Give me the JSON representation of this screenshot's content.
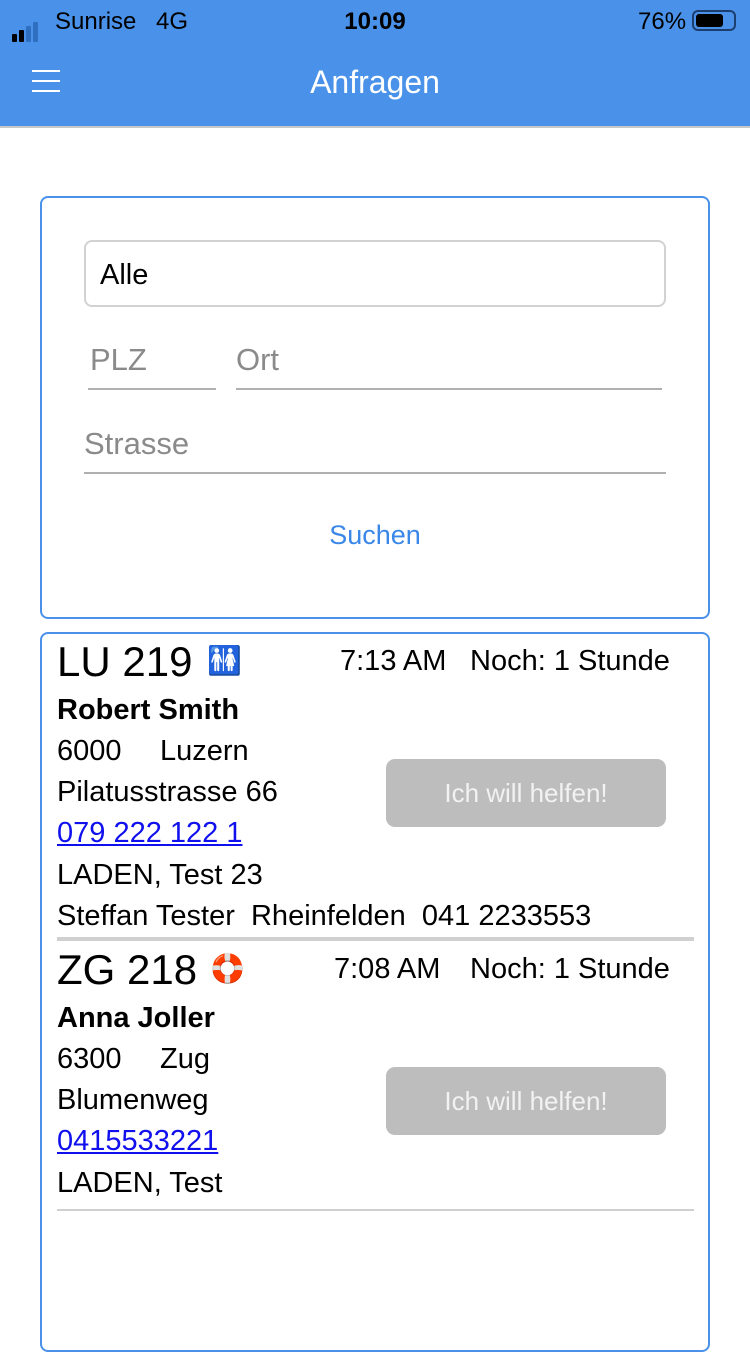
{
  "status": {
    "carrier": "Sunrise",
    "network": "4G",
    "time": "10:09",
    "battery": "76%",
    "battery_level": 0.76
  },
  "nav": {
    "title": "Anfragen",
    "menu_icon": "hamburger-icon"
  },
  "filter": {
    "category": "Alle",
    "plz_placeholder": "PLZ",
    "ort_placeholder": "Ort",
    "strasse_placeholder": "Strasse",
    "search_label": "Suchen"
  },
  "requests": [
    {
      "code": "LU 219",
      "icon": "people-icon",
      "time": "7:13 AM",
      "remaining": "Noch: 1 Stunde",
      "name": "Robert Smith",
      "plz": "6000",
      "city": "Luzern",
      "street": "Pilatusstrasse 66",
      "phone": "079 222 122 1",
      "shop": "LADEN, Test 23",
      "contact": "Steffan Tester  Rheinfelden  041 2233553",
      "button": "Ich will helfen!"
    },
    {
      "code": "ZG 218",
      "icon": "lifebuoy-icon",
      "time": "7:08 AM",
      "remaining": "Noch: 1 Stunde",
      "name": "Anna Joller",
      "plz": "6300",
      "city": "Zug",
      "street": "Blumenweg",
      "phone": "0415533221",
      "shop": "LADEN, Test",
      "button": "Ich will helfen!"
    }
  ]
}
